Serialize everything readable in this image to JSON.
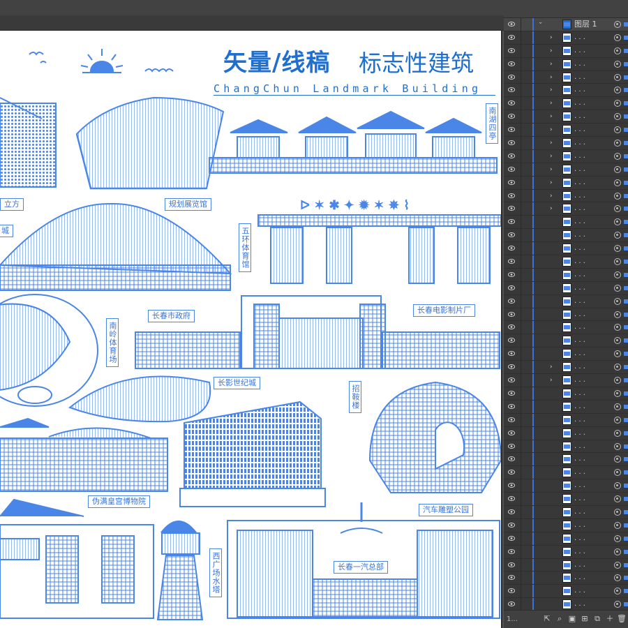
{
  "title": {
    "main": "矢量/线稿",
    "sub": "标志性建筑",
    "english": "ChangChun Landmark Building"
  },
  "labels": {
    "nanhu": "南湖四亭",
    "guihua": "规划展览馆",
    "wuhuan": "五环体育馆",
    "zhengfu": "长春市政府",
    "dianying": "长春电影制片厂",
    "nanling": "南岭体育场",
    "shijicheng": "长影世纪城",
    "zhusu": "招鞍楼",
    "weiman": "伪满皇宫博物院",
    "qiche": "汽车雕塑公园",
    "shuita": "西广场水塔",
    "yiqi": "长春一汽总部",
    "lifang": "立方",
    "cheng": "城"
  },
  "layers_panel": {
    "group_name": "图层 1",
    "row_name": ". . .",
    "rows": [
      {
        "chevron": true
      },
      {
        "chevron": true
      },
      {
        "chevron": true
      },
      {
        "chevron": true
      },
      {
        "chevron": true
      },
      {
        "chevron": true
      },
      {
        "chevron": true
      },
      {
        "chevron": true
      },
      {
        "chevron": true
      },
      {
        "chevron": true
      },
      {
        "chevron": true
      },
      {
        "chevron": true
      },
      {
        "chevron": true
      },
      {
        "chevron": true
      },
      {
        "chevron": false
      },
      {
        "chevron": false
      },
      {
        "chevron": false
      },
      {
        "chevron": false
      },
      {
        "chevron": false
      },
      {
        "chevron": false
      },
      {
        "chevron": false
      },
      {
        "chevron": false
      },
      {
        "chevron": false
      },
      {
        "chevron": false
      },
      {
        "chevron": false
      },
      {
        "chevron": true
      },
      {
        "chevron": true
      },
      {
        "chevron": false
      },
      {
        "chevron": false
      },
      {
        "chevron": false
      },
      {
        "chevron": false
      },
      {
        "chevron": false
      },
      {
        "chevron": false
      },
      {
        "chevron": false
      },
      {
        "chevron": false
      },
      {
        "chevron": false
      },
      {
        "chevron": false
      },
      {
        "chevron": false
      },
      {
        "chevron": false
      },
      {
        "chevron": false
      },
      {
        "chevron": false
      },
      {
        "chevron": false
      },
      {
        "chevron": false
      },
      {
        "chevron": false
      },
      {
        "chevron": false
      }
    ],
    "footer_count": "1..."
  },
  "colors": {
    "accent": "#1e6fd0",
    "line": "#4a85e8",
    "panel": "#383838"
  }
}
